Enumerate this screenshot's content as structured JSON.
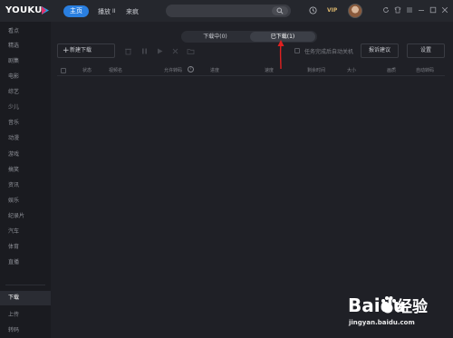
{
  "app": {
    "logo_text": "YOUKU"
  },
  "topnav": {
    "home": "主页",
    "play": "播放",
    "play_icon": "II",
    "lai": "来疯",
    "vip": "VIP"
  },
  "sidebar": {
    "items": [
      {
        "label": "看点"
      },
      {
        "label": "精选"
      },
      {
        "label": "剧集"
      },
      {
        "label": "电影"
      },
      {
        "label": "综艺"
      },
      {
        "label": "少儿"
      },
      {
        "label": "音乐"
      },
      {
        "label": "动漫"
      },
      {
        "label": "游戏"
      },
      {
        "label": "搞笑"
      },
      {
        "label": "资讯"
      },
      {
        "label": "娱乐"
      },
      {
        "label": "纪录片"
      },
      {
        "label": "汽车"
      },
      {
        "label": "体育"
      },
      {
        "label": "直播"
      }
    ],
    "bottom_items": [
      {
        "label": "下载",
        "active": true
      },
      {
        "label": "上传"
      },
      {
        "label": "转码"
      }
    ]
  },
  "downloads": {
    "tab_downloading": "下载中(0)",
    "tab_downloaded": "已下载(1)",
    "new_download": "新建下载",
    "auto_shutdown": "任务完成后自动关机",
    "feedback": "报诉建议",
    "settings": "设置"
  },
  "table": {
    "columns": [
      "状态",
      "视频名",
      "允许转码",
      "进度",
      "速度",
      "剩余时间",
      "大小",
      "画质",
      "自动转码"
    ]
  },
  "watermark": {
    "baidu": "Baidu",
    "jingyan": "经验",
    "url": "jingyan.baidu.com"
  },
  "colors": {
    "accent": "#2a7fe0",
    "arrow": "#e02020",
    "background": "#1f2026",
    "sidebar": "#1a1b20"
  }
}
